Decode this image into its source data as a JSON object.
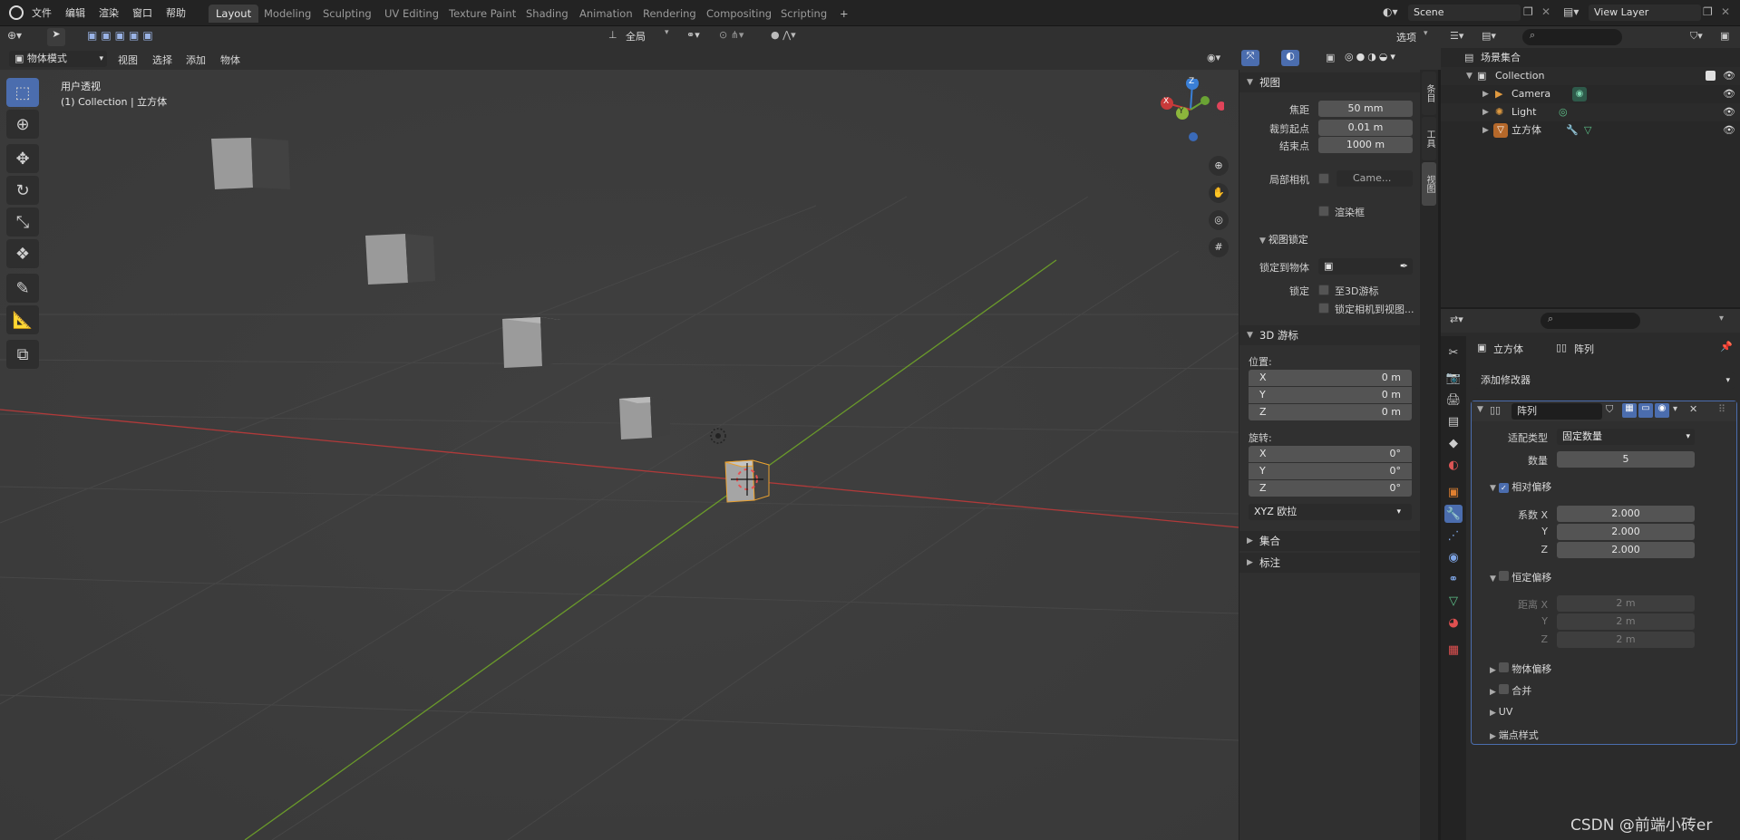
{
  "topbar": {
    "menus": [
      "文件",
      "编辑",
      "渲染",
      "窗口",
      "帮助"
    ],
    "workspaces": [
      "Layout",
      "Modeling",
      "Sculpting",
      "UV Editing",
      "Texture Paint",
      "Shading",
      "Animation",
      "Rendering",
      "Compositing",
      "Scripting"
    ],
    "active_workspace": "Layout",
    "add_tab": "+",
    "scene": "Scene",
    "view_layer": "View Layer"
  },
  "tool_header": {
    "transform_orientation": "全局",
    "options": "选项"
  },
  "viewport_header": {
    "mode": "物体模式",
    "menus": [
      "视图",
      "选择",
      "添加",
      "物体"
    ]
  },
  "viewport": {
    "view_name": "用户透视",
    "collection_info": "(1) Collection | 立方体",
    "gizmo": {
      "z": "Z",
      "x": "X",
      "y": "Y"
    }
  },
  "npanel": {
    "view_section": "视图",
    "focal_label": "焦距",
    "focal_value": "50 mm",
    "clip_start_label": "裁剪起点",
    "clip_start_value": "0.01 m",
    "clip_end_label": "结束点",
    "clip_end_value": "1000 m",
    "local_camera_label": "局部相机",
    "local_camera_value": "Came...",
    "render_region_label": "渲染框",
    "view_lock_section": "视图锁定",
    "lock_to_object_label": "锁定到物体",
    "lock_label": "锁定",
    "lock_3d_cursor": "至3D游标",
    "lock_camera_view": "锁定相机到视图...",
    "cursor_section": "3D 游标",
    "location_label": "位置:",
    "location": [
      {
        "axis": "X",
        "value": "0 m"
      },
      {
        "axis": "Y",
        "value": "0 m"
      },
      {
        "axis": "Z",
        "value": "0 m"
      }
    ],
    "rotation_label": "旋转:",
    "rotation": [
      {
        "axis": "X",
        "value": "0°"
      },
      {
        "axis": "Y",
        "value": "0°"
      },
      {
        "axis": "Z",
        "value": "0°"
      }
    ],
    "rotation_mode": "XYZ 欧拉",
    "collections_section": "集合",
    "annotations_section": "标注",
    "tabs": [
      "条目",
      "工具",
      "视图"
    ]
  },
  "outliner": {
    "root": "场景集合",
    "collection": "Collection",
    "items": [
      "Camera",
      "Light",
      "立方体"
    ]
  },
  "properties": {
    "object_name": "立方体",
    "modifier_crumb": "阵列",
    "add_modifier": "添加修改器",
    "modifier_name": "阵列",
    "fit_type_label": "适配类型",
    "fit_type_value": "固定数量",
    "count_label": "数量",
    "count_value": "5",
    "relative_offset_label": "相对偏移",
    "factor_x_label": "系数 X",
    "factor_x": "2.000",
    "factor_y_label": "Y",
    "factor_y": "2.000",
    "factor_z_label": "Z",
    "factor_z": "2.000",
    "constant_offset_label": "恒定偏移",
    "distance_x_label": "距离 X",
    "distance_x": "2 m",
    "distance_y_label": "Y",
    "distance_y": "2 m",
    "distance_z_label": "Z",
    "distance_z": "2 m",
    "object_offset_label": "物体偏移",
    "merge_label": "合并",
    "uv_label": "UV",
    "caps_label": "端点样式"
  },
  "watermark": "CSDN @前端小砖er",
  "colors": {
    "accent": "#4b6dae",
    "x_axis": "#c83a3a",
    "y_axis": "#6aa334",
    "z_axis": "#3a7fd6"
  }
}
